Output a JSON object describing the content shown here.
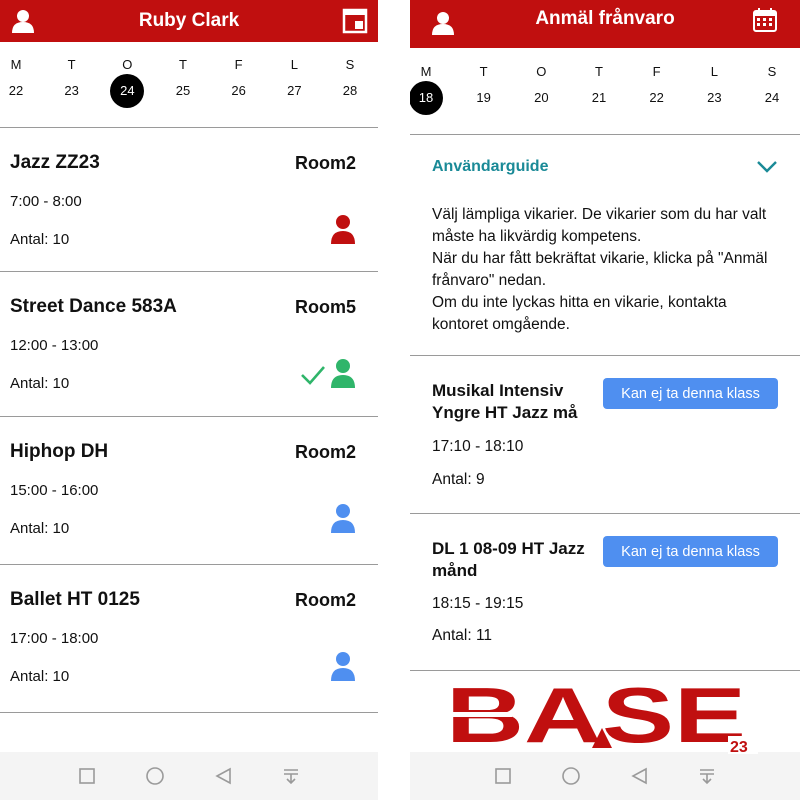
{
  "left": {
    "header": {
      "title": "Ruby Clark",
      "left_icon": "user-icon",
      "right_icon": "calendar-today-icon"
    },
    "calendar": {
      "weekdays": [
        "M",
        "T",
        "O",
        "T",
        "F",
        "L",
        "S"
      ],
      "dates": [
        "22",
        "23",
        "24",
        "25",
        "26",
        "27",
        "28"
      ],
      "selected_index": 2
    },
    "classes": [
      {
        "name": "Jazz ZZ23",
        "room": "Room2",
        "time": "7:00 - 8:00",
        "count": "Antal: 10",
        "status": "red",
        "check": false
      },
      {
        "name": "Street Dance 583A",
        "room": "Room5",
        "time": "12:00 - 13:00",
        "count": "Antal: 10",
        "status": "green",
        "check": true
      },
      {
        "name": "Hiphop DH",
        "room": "Room2",
        "time": "15:00 - 16:00",
        "count": "Antal: 10",
        "status": "blue",
        "check": false
      },
      {
        "name": "Ballet HT 0125",
        "room": "Room2",
        "time": "17:00 - 18:00",
        "count": "Antal: 10",
        "status": "blue",
        "check": false
      }
    ]
  },
  "right": {
    "header": {
      "title": "Anmäl frånvaro",
      "left_icon": "user-icon",
      "right_icon": "calendar-icon"
    },
    "calendar": {
      "weekdays": [
        "M",
        "T",
        "O",
        "T",
        "F",
        "L",
        "S"
      ],
      "dates": [
        "18",
        "19",
        "20",
        "21",
        "22",
        "23",
        "24"
      ],
      "selected_index": 0
    },
    "guide": {
      "title": "Användarguide",
      "lines": [
        "Välj lämpliga vikarier. De vikarier som du har valt måste ha likvärdig kompetens.",
        "När du har fått bekräftat vikarie, klicka på \"Anmäl frånvaro\" nedan.",
        "Om du inte lyckas hitta en vikarie, kontakta kontoret omgående."
      ]
    },
    "classes": [
      {
        "name": "Musikal Intensiv Yngre HT Jazz må",
        "button": "Kan ej ta denna klass",
        "time": "17:10 - 18:10",
        "count": "Antal: 9"
      },
      {
        "name": "DL 1 08-09 HT Jazz månd",
        "button": "Kan ej ta denna klass",
        "time": "18:15 - 19:15",
        "count": "Antal: 11"
      }
    ],
    "logo": {
      "text": "BASE",
      "number": "23"
    }
  },
  "colors": {
    "brand_red": "#c00f0f",
    "status_red": "#c00f0f",
    "status_green": "#2fb56a",
    "status_blue": "#4f8ff0",
    "link_teal": "#1a8a97",
    "button_blue": "#4f8ff0"
  },
  "navbar": {
    "icons": [
      "square-icon",
      "circle-icon",
      "back-triangle-icon",
      "download-icon"
    ]
  }
}
